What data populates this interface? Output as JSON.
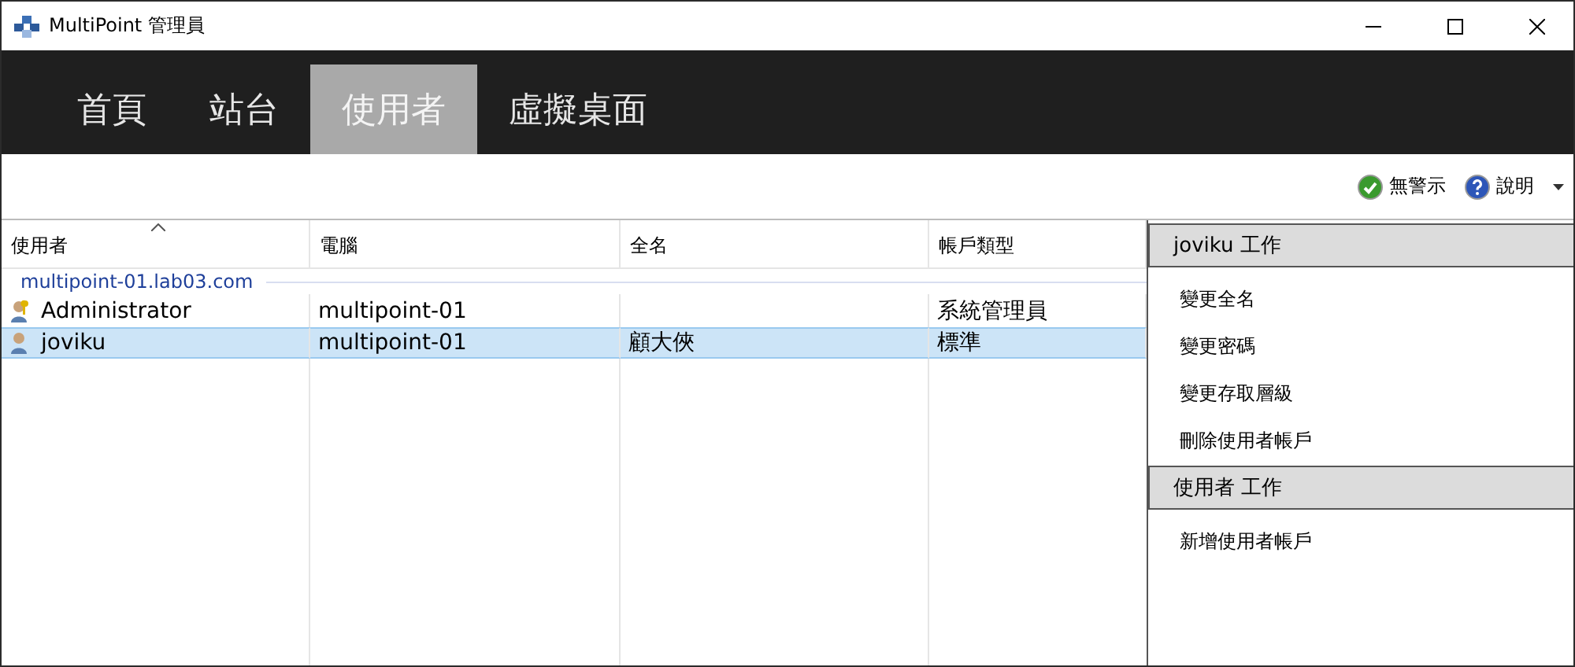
{
  "window": {
    "title": "MultiPoint 管理員"
  },
  "tabs": [
    {
      "label": "首頁",
      "selected": false
    },
    {
      "label": "站台",
      "selected": false
    },
    {
      "label": "使用者",
      "selected": true
    },
    {
      "label": "虛擬桌面",
      "selected": false
    }
  ],
  "toolbar": {
    "alerts": "無警示",
    "help": "說明"
  },
  "table": {
    "columns": [
      "使用者",
      "電腦",
      "全名",
      "帳戶類型"
    ],
    "group": "multipoint-01.lab03.com",
    "rows": [
      {
        "kind": "admin",
        "selected": false,
        "cells": [
          "Administrator",
          "multipoint-01",
          "",
          "系統管理員"
        ]
      },
      {
        "kind": "user",
        "selected": true,
        "cells": [
          "joviku",
          "multipoint-01",
          "顧大俠",
          "標準"
        ]
      }
    ]
  },
  "task_pane": {
    "sections": [
      {
        "title": "joviku 工作",
        "items": [
          "變更全名",
          "變更密碼",
          "變更存取層級",
          "刪除使用者帳戶"
        ]
      },
      {
        "title": "使用者 工作",
        "items": [
          "新增使用者帳戶"
        ]
      }
    ]
  }
}
